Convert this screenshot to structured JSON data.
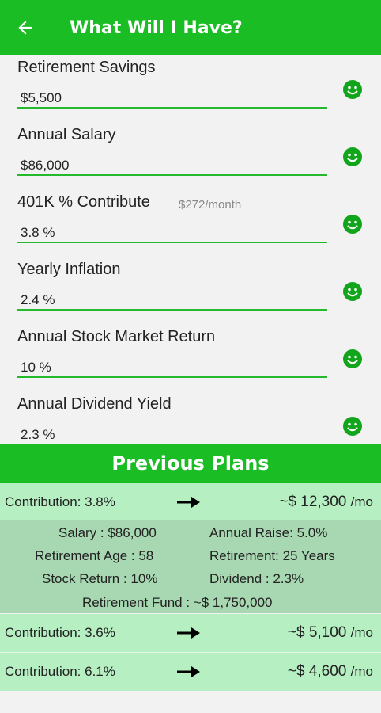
{
  "appbar": {
    "title": "What Will I Have?"
  },
  "fields": [
    {
      "label": "Retirement Savings",
      "value": "$5,500",
      "hint": ""
    },
    {
      "label": "Annual Salary",
      "value": "$86,000",
      "hint": ""
    },
    {
      "label": "401K % Contribute",
      "value": "3.8 %",
      "hint": "$272/month"
    },
    {
      "label": "Yearly Inflation",
      "value": "2.4 %",
      "hint": ""
    },
    {
      "label": "Annual Stock Market Return",
      "value": "10 %",
      "hint": ""
    },
    {
      "label": "Annual Dividend Yield",
      "value": "2.3 %",
      "hint": ""
    }
  ],
  "previous_plans": {
    "title": "Previous Plans",
    "plans": [
      {
        "contribution": "Contribution: 3.8%",
        "result": "~$ 12,300",
        "unit": "/mo"
      },
      {
        "contribution": "Contribution: 3.6%",
        "result": "~$ 5,100",
        "unit": "/mo"
      },
      {
        "contribution": "Contribution: 6.1%",
        "result": "~$ 4,600",
        "unit": "/mo"
      }
    ],
    "details": {
      "salary": "Salary : $86,000",
      "annual_raise": "Annual Raise: 5.0%",
      "retirement_age": "Retirement Age : 58",
      "retirement_years": "Retirement: 25 Years",
      "stock_return": "Stock Return : 10%",
      "dividend": "Dividend : 2.3%",
      "retirement_fund": "Retirement Fund : ~$ 1,750,000"
    }
  },
  "colors": {
    "primary": "#1bbd25",
    "plan_bg": "#b6efc2",
    "details_bg": "#a7d8b1",
    "underline": "#25b92e"
  }
}
